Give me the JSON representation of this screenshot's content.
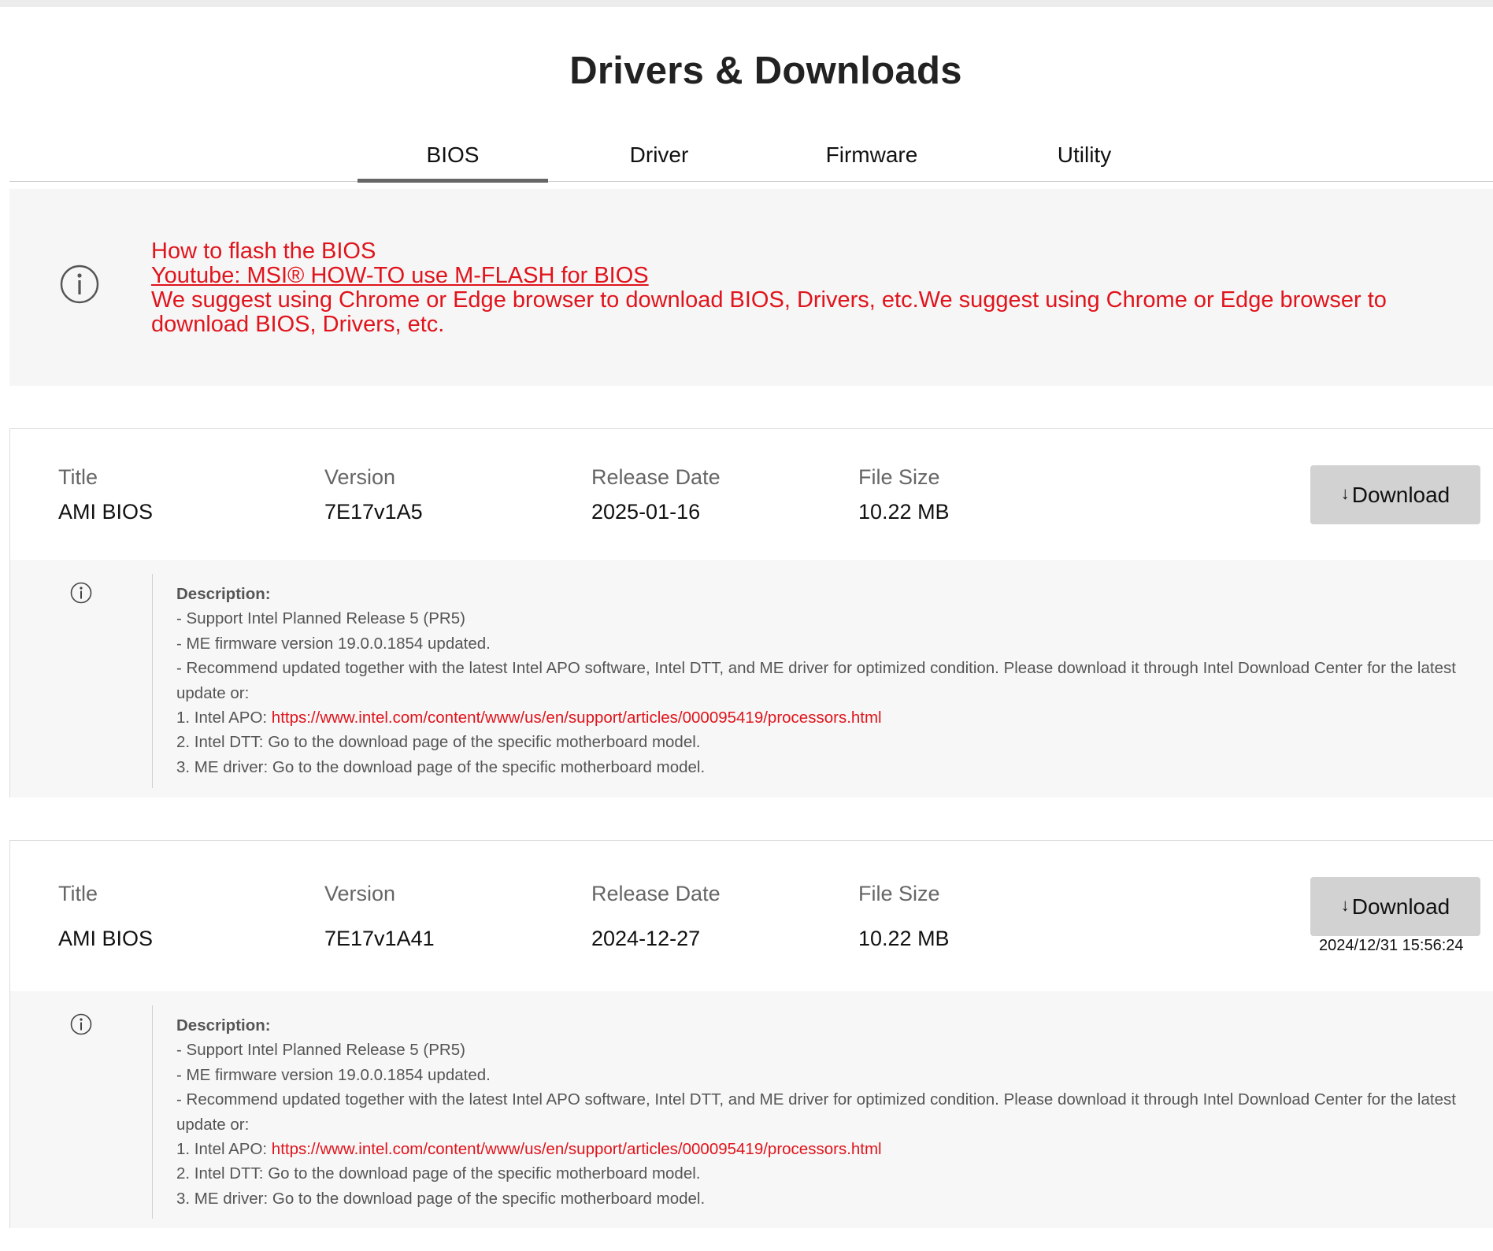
{
  "page": {
    "title": "Drivers & Downloads"
  },
  "tabs": [
    {
      "label": "BIOS",
      "active": true
    },
    {
      "label": "Driver",
      "active": false
    },
    {
      "label": "Firmware",
      "active": false
    },
    {
      "label": "Utility",
      "active": false
    }
  ],
  "notice": {
    "icon": "info-circle-icon",
    "color": "#e0141c",
    "line1": "How to flash the BIOS",
    "link": "Youtube: MSI® HOW-TO use M-FLASH for BIOS",
    "line3": "We suggest using Chrome or Edge browser to download BIOS, Drivers, etc.We suggest using Chrome or Edge browser to download BIOS, Drivers, etc."
  },
  "labels": {
    "title": "Title",
    "version": "Version",
    "release_date": "Release Date",
    "file_size": "File Size",
    "download": "Download",
    "description": "Description:"
  },
  "items": [
    {
      "title": "AMI BIOS",
      "version": "7E17v1A5",
      "release_date": "2025-01-16",
      "file_size": "10.22 MB",
      "timestamp": "",
      "desc": {
        "l1": "- Support Intel Planned Release 5 (PR5)",
        "l2": "- ME firmware version 19.0.0.1854 updated.",
        "l3": "- Recommend updated together with the latest Intel APO software, Intel DTT, and ME driver for optimized condition. Please download it through Intel Download Center for the latest update or:",
        "l4_prefix": "1. Intel APO: ",
        "l4_link": "https://www.intel.com/content/www/us/en/support/articles/000095419/processors.html",
        "l5": "2. Intel DTT: Go to the download page of the specific motherboard model.",
        "l6": "3. ME driver: Go to the download page of the specific motherboard model."
      }
    },
    {
      "title": "AMI BIOS",
      "version": "7E17v1A41",
      "release_date": "2024-12-27",
      "file_size": "10.22 MB",
      "timestamp": "2024/12/31 15:56:24",
      "desc": {
        "l1": "- Support Intel Planned Release 5 (PR5)",
        "l2": "- ME firmware version 19.0.0.1854 updated.",
        "l3": "- Recommend updated together with the latest Intel APO software, Intel DTT, and ME driver for optimized condition. Please download it through Intel Download Center for the latest update or:",
        "l4_prefix": "1. Intel APO: ",
        "l4_link": "https://www.intel.com/content/www/us/en/support/articles/000095419/processors.html",
        "l5": "2. Intel DTT: Go to the download page of the specific motherboard model.",
        "l6": "3. ME driver: Go to the download page of the specific motherboard model."
      }
    }
  ]
}
